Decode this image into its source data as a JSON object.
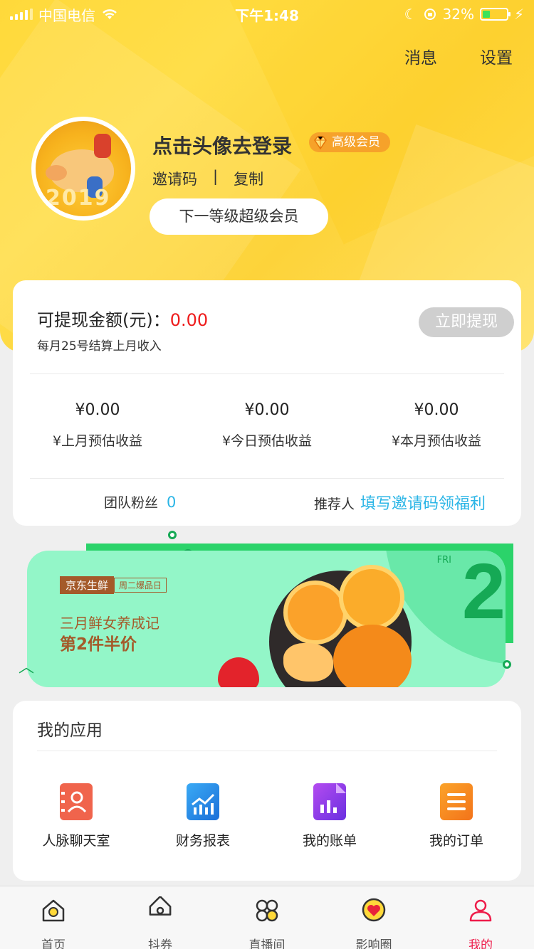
{
  "status_bar": {
    "carrier": "中国电信",
    "time": "下午1:48",
    "battery_percent": "32%",
    "battery_level": 0.32
  },
  "header": {
    "messages_label": "消息",
    "settings_label": "设置",
    "login_prompt": "点击头像去登录",
    "member_badge": "高级会员",
    "invite_code_label": "邀请码",
    "separator": "|",
    "copy_label": "复制",
    "next_level_button": "下一等级超级会员",
    "avatar_year": "2019"
  },
  "earnings_card": {
    "withdraw_label": "可提现金额(元)：",
    "withdraw_amount": "0.00",
    "settlement_note": "每月25号结算上月收入",
    "withdraw_button": "立即提现",
    "stats": [
      {
        "value": "¥0.00",
        "label": "¥上月预估收益"
      },
      {
        "value": "¥0.00",
        "label": "¥今日预估收益"
      },
      {
        "value": "¥0.00",
        "label": "¥本月预估收益"
      }
    ],
    "team_fans_label": "团队粉丝",
    "team_fans_count": "0",
    "referrer_label": "推荐人",
    "referrer_link": "填写邀请码领福利"
  },
  "banner": {
    "brand": "京东生鲜",
    "brand_sub": "周二爆品日",
    "line1": "三月鲜女养成记",
    "line2": "第2件半价",
    "day": "FRI",
    "number": "2"
  },
  "apps": {
    "title": "我的应用",
    "items": [
      {
        "label": "人脉聊天室",
        "icon": "contacts-icon",
        "color": "#f0644c"
      },
      {
        "label": "财务报表",
        "icon": "chart-report-icon",
        "color": "#2a8ee8"
      },
      {
        "label": "我的账单",
        "icon": "bill-icon",
        "color": "#8a3ee6"
      },
      {
        "label": "我的订单",
        "icon": "order-list-icon",
        "color": "#f5891a"
      }
    ]
  },
  "tabbar": {
    "items": [
      {
        "label": "首页",
        "icon": "home-icon"
      },
      {
        "label": "抖券",
        "icon": "coupon-tag-icon"
      },
      {
        "label": "直播间",
        "icon": "live-grid-icon"
      },
      {
        "label": "影响圈",
        "icon": "heart-chat-icon"
      },
      {
        "label": "我的",
        "icon": "profile-icon",
        "active": true
      }
    ]
  },
  "colors": {
    "header_yellow": "#ffd93a",
    "accent_red": "#ee1c1c",
    "link_blue": "#2ab5e6",
    "badge_orange": "#f6a22a",
    "tab_active": "#ee1c4a"
  }
}
